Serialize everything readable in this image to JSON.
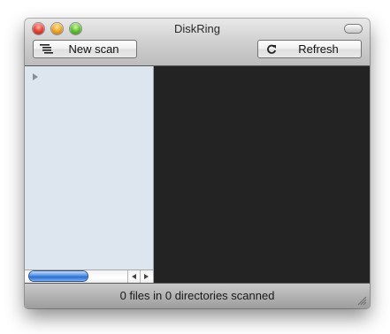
{
  "window": {
    "title": "DiskRing"
  },
  "toolbar": {
    "new_scan_label": "New scan",
    "new_scan_icon": "list-indent-icon",
    "refresh_label": "Refresh",
    "refresh_icon": "refresh-arrow-icon"
  },
  "status": {
    "text": "0 files in 0 directories scanned"
  },
  "colors": {
    "sidebar_bg": "#dde5ee",
    "chart_bg": "#232323",
    "scroll_thumb": "#3b7ad9"
  }
}
